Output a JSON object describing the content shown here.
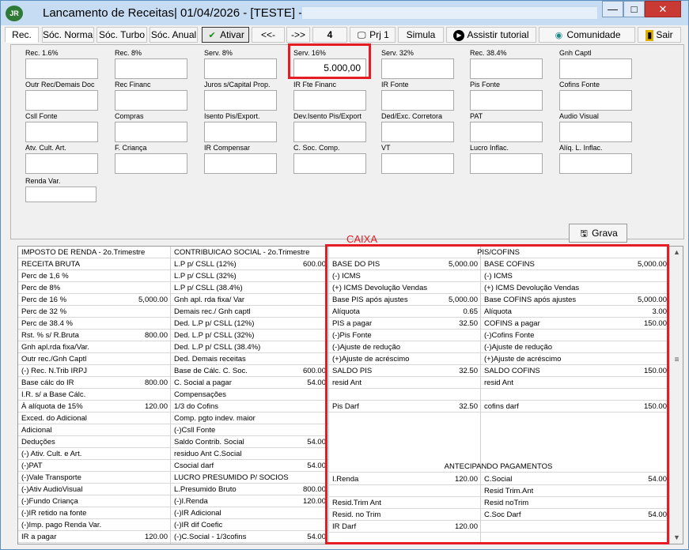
{
  "window": {
    "title": "Lancamento de Receitas|  01/04/2026 - [TESTE] -",
    "app_icon_text": "JR",
    "minimize": "—",
    "maximize": "□",
    "close": "✕"
  },
  "toolbar": {
    "tabs": [
      "Rec.",
      "Sóc. Normal",
      "Sóc. Turbo",
      "Sóc. Anual"
    ],
    "ativar": "Ativar",
    "prev": "<<-",
    "next": "->>",
    "page": "4",
    "prj": "Prj 1",
    "simula": "Simula",
    "tutorial": "Assistir tutorial",
    "comunidade": "Comunidade",
    "sair": "Sair",
    "icons": [
      "check-icon",
      "monitor-icon",
      "play-icon",
      "community-icon",
      "exit-door-icon"
    ]
  },
  "fields": [
    {
      "label": "Rec. 1.6%",
      "value": ""
    },
    {
      "label": "Rec. 8%",
      "value": ""
    },
    {
      "label": "Serv. 8%",
      "value": ""
    },
    {
      "label": "Serv. 16%",
      "value": "5.000,00"
    },
    {
      "label": "Serv. 32%",
      "value": ""
    },
    {
      "label": "Rec. 38.4%",
      "value": ""
    },
    {
      "label": "Gnh Captl",
      "value": ""
    },
    {
      "label": "Outr Rec/Demais Doc",
      "value": ""
    },
    {
      "label": "Rec Financ",
      "value": ""
    },
    {
      "label": "Juros s/Capital Prop.",
      "value": ""
    },
    {
      "label": "IR Fte Financ",
      "value": ""
    },
    {
      "label": "IR Fonte",
      "value": ""
    },
    {
      "label": "Pis Fonte",
      "value": ""
    },
    {
      "label": "Cofins Fonte",
      "value": ""
    },
    {
      "label": "Csll Fonte",
      "value": ""
    },
    {
      "label": "Compras",
      "value": ""
    },
    {
      "label": "Isento Pis/Export.",
      "value": ""
    },
    {
      "label": "Dev.Isento Pis/Export",
      "value": ""
    },
    {
      "label": "Ded/Exc. Corretora",
      "value": ""
    },
    {
      "label": "PAT",
      "value": ""
    },
    {
      "label": "Audio Visual",
      "value": ""
    },
    {
      "label": "Atv. Cult. Art.",
      "value": ""
    },
    {
      "label": "F. Criança",
      "value": ""
    },
    {
      "label": "IR Compensar",
      "value": ""
    },
    {
      "label": "C. Soc. Comp.",
      "value": ""
    },
    {
      "label": "VT",
      "value": ""
    },
    {
      "label": "Lucro Inflac.",
      "value": ""
    },
    {
      "label": "Alíq. L. Inflac.",
      "value": ""
    },
    {
      "label": "Renda Var.",
      "value": ""
    }
  ],
  "grava": "Grava",
  "caixa": "CAIXA",
  "grid": {
    "ir": [
      [
        "IMPOSTO DE RENDA - 2o.Trimestre",
        ""
      ],
      [
        "RECEITA BRUTA",
        ""
      ],
      [
        "Perc de 1,6 %",
        ""
      ],
      [
        "Perc de 8%",
        ""
      ],
      [
        "Perc de 16 %",
        "5,000.00"
      ],
      [
        "Perc de 32 %",
        ""
      ],
      [
        "Perc de 38.4 %",
        ""
      ],
      [
        "Rst.  % s/ R.Bruta",
        "800.00"
      ],
      [
        "Gnh apl.rda fixa/Var.",
        ""
      ],
      [
        "Outr rec./Gnh Captl",
        ""
      ],
      [
        "(-) Rec. N.Trib IRPJ",
        ""
      ],
      [
        "Base cálc do IR",
        "800.00"
      ],
      [
        "I.R. s/ a Base  Cálc.",
        ""
      ],
      [
        "À alíquota de 15%",
        "120.00"
      ],
      [
        "Exced. do Adicional",
        ""
      ],
      [
        "Adicional",
        ""
      ],
      [
        "Deduções",
        ""
      ],
      [
        "(-) Ativ. Cult. e Art.",
        ""
      ],
      [
        "(-)PAT",
        ""
      ],
      [
        "(-)Vale Transporte",
        ""
      ],
      [
        "(-)Ativ AudioVisual",
        ""
      ],
      [
        "(-)Fundo Criança",
        ""
      ],
      [
        "(-)IR retido na fonte",
        ""
      ],
      [
        "(-)Imp. pago Renda Var.",
        ""
      ],
      [
        "IR a pagar",
        "120.00"
      ]
    ],
    "cs": [
      [
        "CONTRIBUICAO SOCIAL - 2o.Trimestre",
        ""
      ],
      [
        "L.P p/ CSLL (12%)",
        "600.00"
      ],
      [
        "L.P p/ CSLL (32%)",
        ""
      ],
      [
        "L.P p/ CSLL (38.4%)",
        ""
      ],
      [
        "Gnh apl. rda fixa/ Var",
        ""
      ],
      [
        "Demais rec./ Gnh captl",
        ""
      ],
      [
        "Ded. L.P p/ CSLL (12%)",
        ""
      ],
      [
        "Ded. L.P p/ CSLL (32%)",
        ""
      ],
      [
        "Ded. L.P p/ CSLL (38.4%)",
        ""
      ],
      [
        "Ded. Demais receitas",
        ""
      ],
      [
        "Base de Cálc. C. Soc.",
        "600.00"
      ],
      [
        "C. Social a pagar",
        "54.00"
      ],
      [
        "Compensações",
        ""
      ],
      [
        "1/3 do Cofins",
        ""
      ],
      [
        "Comp. pgto indev. maior",
        ""
      ],
      [
        "(-)Csll Fonte",
        ""
      ],
      [
        "Saldo Contrib. Social",
        "54.00"
      ],
      [
        "residuo Ant C.Social",
        ""
      ],
      [
        "Csocial darf",
        "54.00"
      ],
      [
        "LUCRO  PRESUMIDO  P/  SOCIOS",
        ""
      ],
      [
        "L.Presumido Bruto",
        "800.00"
      ],
      [
        "(-)I.Renda",
        "120.00"
      ],
      [
        "(-)IR Adicional",
        ""
      ],
      [
        "(-)IR dif Coefic",
        ""
      ],
      [
        "(-)C.Social - 1/3cofins",
        "54.00"
      ]
    ],
    "pis_title": "PIS/COFINS",
    "pis": [
      [
        "BASE DO PIS",
        "5,000.00"
      ],
      [
        "(-) ICMS",
        ""
      ],
      [
        "(+) ICMS Devolução Vendas",
        ""
      ],
      [
        "Base PIS após ajustes",
        "5,000.00"
      ],
      [
        "Alíquota",
        "0.65"
      ],
      [
        "PIS a pagar",
        "32.50"
      ],
      [
        "(-)Pis Fonte",
        ""
      ],
      [
        "(-)Ajuste de redução",
        ""
      ],
      [
        "(+)Ajuste de acréscimo",
        ""
      ],
      [
        "SALDO PIS",
        "32.50"
      ],
      [
        "resid Ant",
        ""
      ],
      [
        "",
        ""
      ],
      [
        "Pis Darf",
        "32.50"
      ]
    ],
    "cofins": [
      [
        "BASE COFINS",
        "5,000.00"
      ],
      [
        "(-) ICMS",
        ""
      ],
      [
        "(+) ICMS Devolução Vendas",
        ""
      ],
      [
        "Base COFINS após ajustes",
        "5,000.00"
      ],
      [
        "Alíquota",
        "3.00"
      ],
      [
        "COFINS a pagar",
        "150.00"
      ],
      [
        "(-)Cofins Fonte",
        ""
      ],
      [
        "(-)Ajuste de redução",
        ""
      ],
      [
        "(+)Ajuste de acréscimo",
        ""
      ],
      [
        "SALDO COFINS",
        "150.00"
      ],
      [
        "resid Ant",
        ""
      ],
      [
        "",
        ""
      ],
      [
        "cofins darf",
        "150.00"
      ]
    ],
    "anti_title": "ANTECIPANDO PAGAMENTOS",
    "anti_left": [
      [
        "I.Renda",
        "120.00"
      ],
      [
        "",
        ""
      ],
      [
        "Resid.Trim Ant",
        ""
      ],
      [
        "Resid. no Trim",
        ""
      ],
      [
        "IR Darf",
        "120.00"
      ]
    ],
    "anti_right": [
      [
        "C.Social",
        "54.00"
      ],
      [
        "Resid Trim.Ant",
        ""
      ],
      [
        "Resid noTrim",
        ""
      ],
      [
        "C.Soc Darf",
        "54.00"
      ],
      [
        "",
        ""
      ]
    ]
  },
  "colors": {
    "highlight": "#e51c23",
    "titlebar": "#c6dcf2"
  }
}
